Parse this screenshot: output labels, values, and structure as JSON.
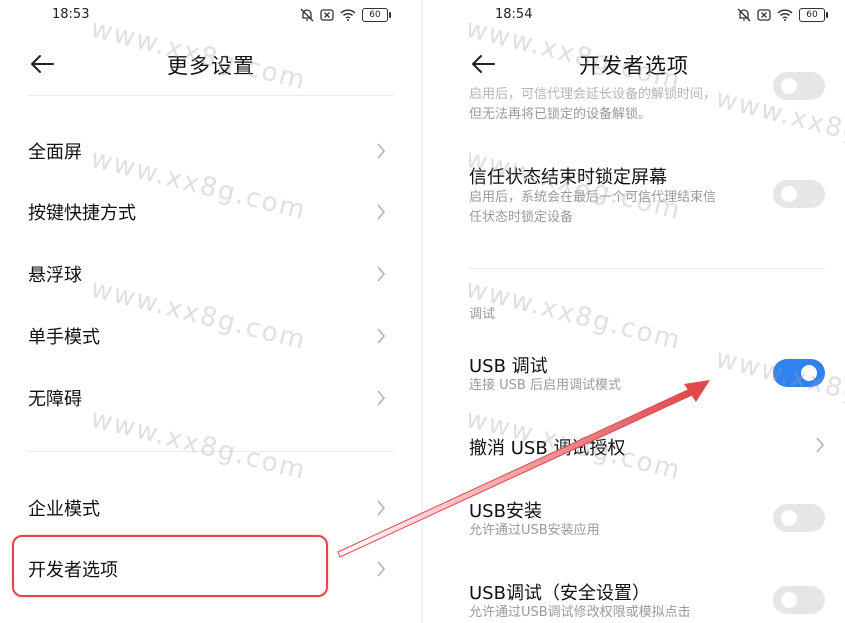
{
  "left": {
    "status_time": "18:53",
    "battery": "60",
    "title": "更多设置",
    "items": [
      {
        "label": "全面屏"
      },
      {
        "label": "按键快捷方式"
      },
      {
        "label": "悬浮球"
      },
      {
        "label": "单手模式"
      },
      {
        "label": "无障碍"
      },
      {
        "label": "企业模式"
      },
      {
        "label": "开发者选项"
      }
    ]
  },
  "right": {
    "status_time": "18:54",
    "battery": "60",
    "title": "开发者选项",
    "partial_desc_1": "启用后，可信代理会延长设备的解锁时间，",
    "partial_desc_2": "但无法再将已锁定的设备解锁。",
    "trust_lock": {
      "title": "信任状态结束时锁定屏幕",
      "desc_1": "启用后，系统会在最后一个可信代理结束信",
      "desc_2": "任状态时锁定设备",
      "enabled": false
    },
    "section_debug": "调试",
    "usb_debug": {
      "title": "USB 调试",
      "desc": "连接 USB 后启用调试模式",
      "enabled": true
    },
    "revoke_usb": {
      "title": "撤消 USB 调试授权"
    },
    "usb_install": {
      "title": "USB安装",
      "desc": "允许通过USB安装应用",
      "enabled": false
    },
    "usb_debug_secure": {
      "title": "USB调试（安全设置）",
      "desc": "允许通过USB调试修改权限或模拟点击",
      "enabled": false
    }
  },
  "watermark": "www.xx8g.com",
  "colors": {
    "accent": "#3082f0",
    "highlight": "#e0484e",
    "arrow": "#e0484e"
  }
}
